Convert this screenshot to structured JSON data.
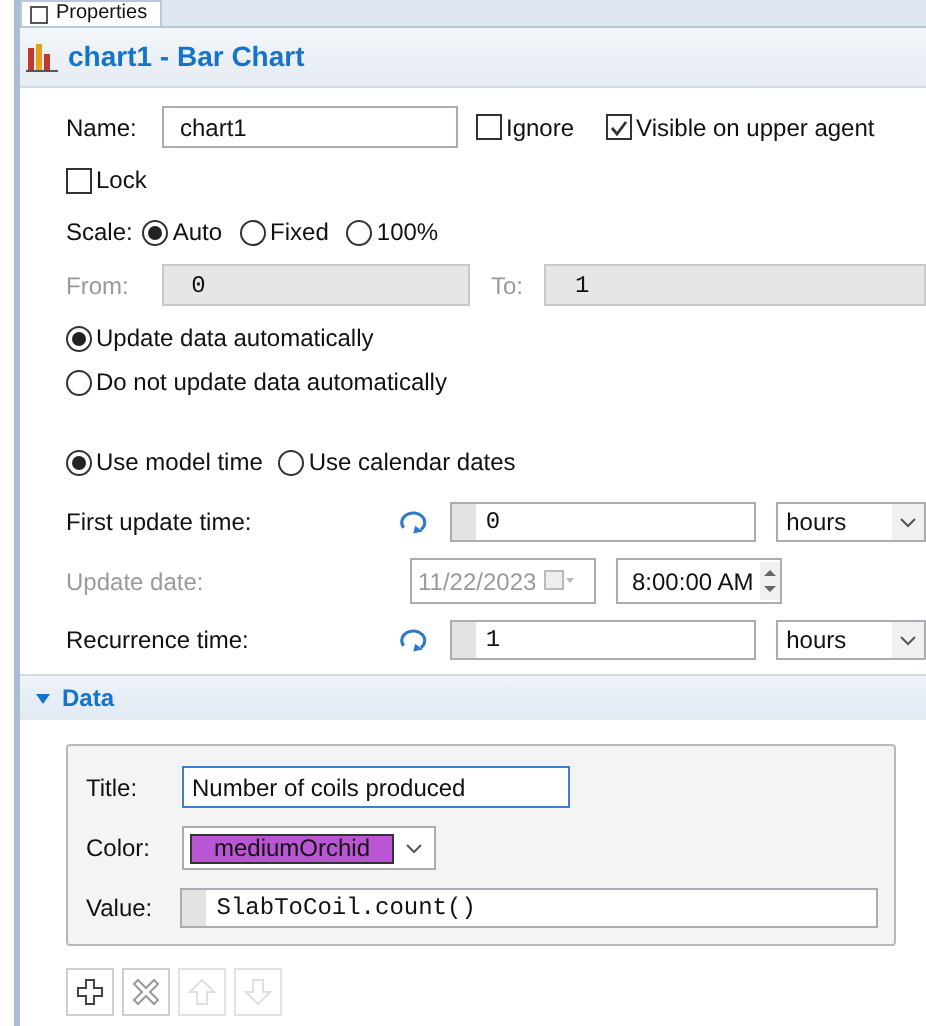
{
  "tab": {
    "label": "Properties"
  },
  "header": {
    "title": "chart1 - Bar Chart"
  },
  "name": {
    "label": "Name:",
    "value": "chart1"
  },
  "flags": [
    {
      "label": "Ignore",
      "checked": false
    },
    {
      "label": "Visible on upper agent",
      "checked": true
    }
  ],
  "lock": {
    "label": "Lock",
    "checked": false
  },
  "scale": {
    "label": "Scale:",
    "options": [
      {
        "label": "Auto",
        "selected": true
      },
      {
        "label": "Fixed",
        "selected": false
      },
      {
        "label": "100%",
        "selected": false
      }
    ]
  },
  "range": {
    "from_label": "From:",
    "from_value": "0",
    "to_label": "To:",
    "to_value": "1",
    "disabled": true
  },
  "update_mode": [
    {
      "label": "Update data automatically",
      "selected": true
    },
    {
      "label": "Do not update data automatically",
      "selected": false
    }
  ],
  "time_mode": [
    {
      "label": "Use model time",
      "selected": true
    },
    {
      "label": "Use calendar dates",
      "selected": false
    }
  ],
  "first_update": {
    "label": "First update time:",
    "value": "0",
    "unit": "hours"
  },
  "update_date": {
    "label": "Update date:",
    "date": "11/22/2023",
    "time": "8:00:00 AM",
    "disabled": true
  },
  "recurrence": {
    "label": "Recurrence time:",
    "value": "1",
    "unit": "hours"
  },
  "data_section": {
    "title": "Data",
    "expanded": true,
    "title_label": "Title:",
    "title_value": "Number of coils produced",
    "color_label": "Color:",
    "color_name": "mediumOrchid",
    "color": "#ba55d3",
    "value_label": "Value:",
    "value": "SlabToCoil.count()"
  },
  "toolbar": [
    {
      "kind": "add",
      "disabled": false
    },
    {
      "kind": "remove",
      "disabled": false
    },
    {
      "kind": "up",
      "disabled": true
    },
    {
      "kind": "down",
      "disabled": true
    }
  ]
}
